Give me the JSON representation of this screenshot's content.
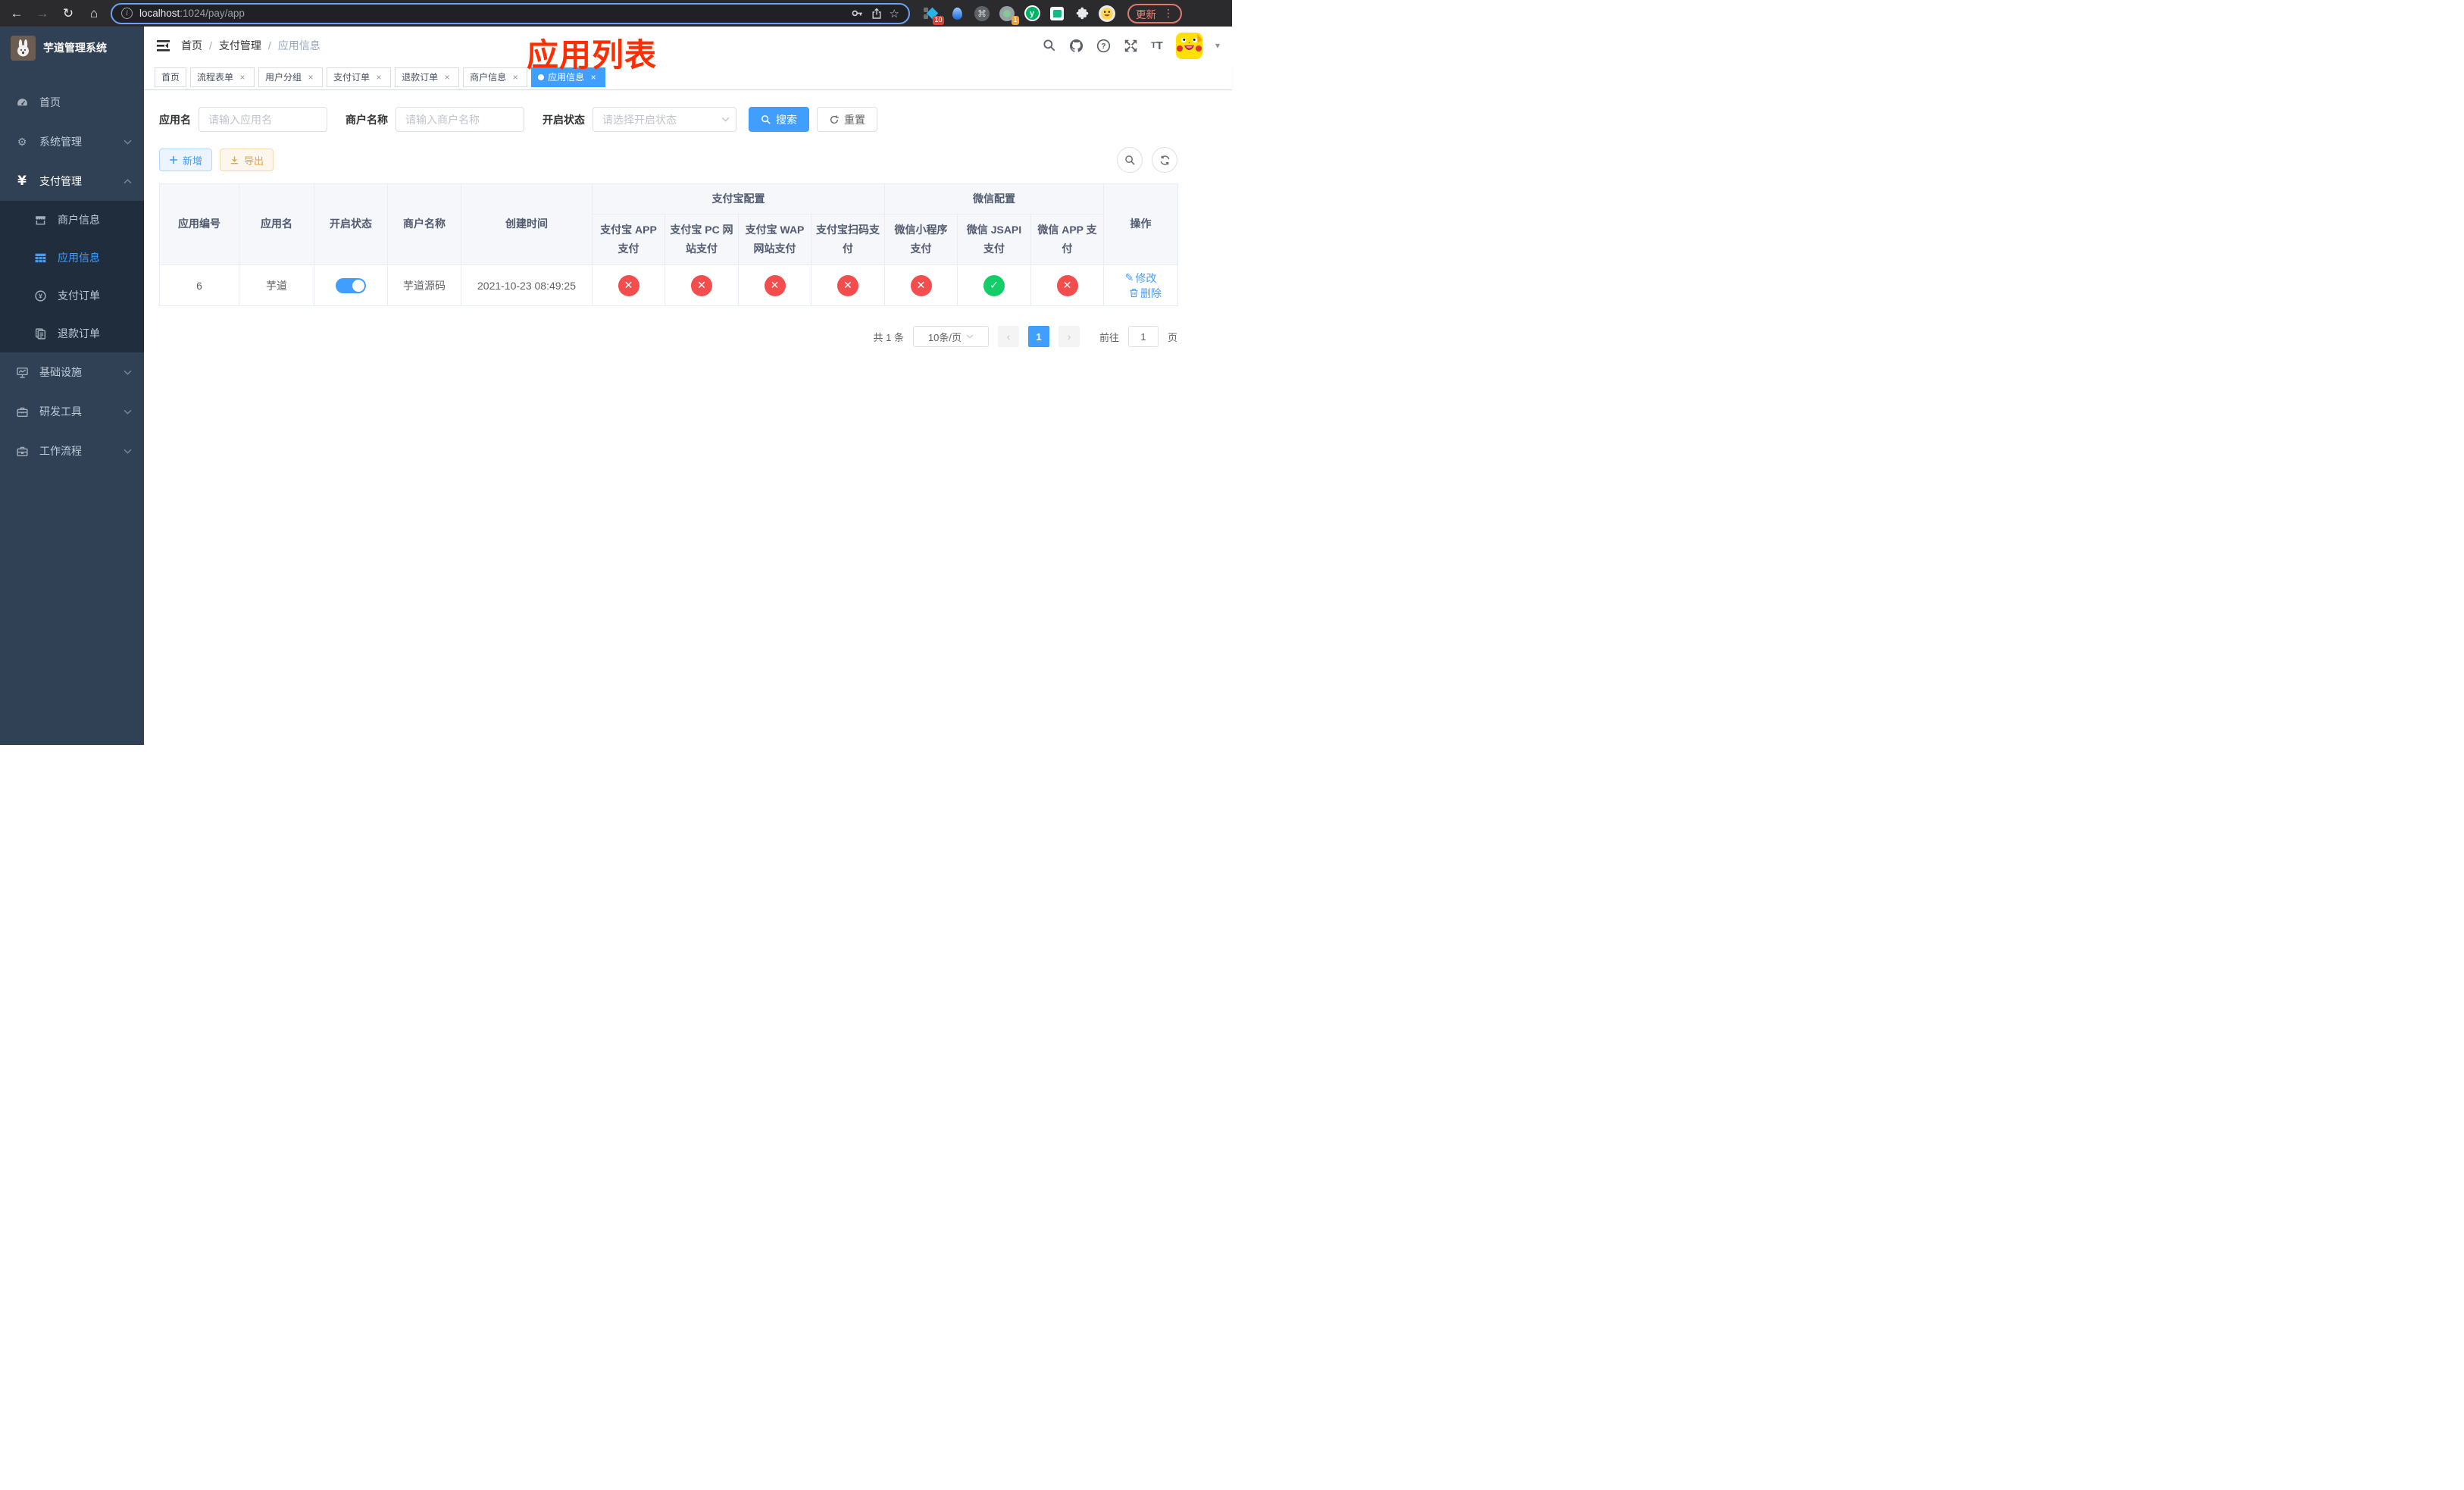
{
  "colors": {
    "accent": "#409EFF",
    "success": "#13ce66",
    "danger": "#f34d4d"
  },
  "icons": {
    "back": "←",
    "forward": "→",
    "reload": "↻",
    "home": "⌂",
    "star": "☆",
    "command": "⌘",
    "menu_dots": "⋮",
    "caret_down": "▾",
    "gear": "⚙",
    "yen": "¥",
    "edit": "✎",
    "info": "i",
    "close": "×",
    "pager_prev": "‹",
    "pager_next": "›",
    "y_logo": "y",
    "question": "?"
  },
  "browser": {
    "url_host": "localhost",
    "url_rest": ":1024/pay/app",
    "update_label": "更新",
    "ext_badge_blue_diamond": "10",
    "ext_badge_recorder": "1"
  },
  "sidebar": {
    "title": "芋道管理系统",
    "items": [
      {
        "label": "首页"
      },
      {
        "label": "系统管理"
      },
      {
        "label": "支付管理"
      },
      {
        "label": "基础设施"
      },
      {
        "label": "研发工具"
      },
      {
        "label": "工作流程"
      }
    ],
    "submenu": [
      {
        "label": "商户信息"
      },
      {
        "label": "应用信息"
      },
      {
        "label": "支付订单"
      },
      {
        "label": "退款订单"
      }
    ]
  },
  "navbar": {
    "breadcrumb": [
      "首页",
      "支付管理",
      "应用信息"
    ],
    "separator": "/",
    "annotation": "应用列表"
  },
  "tabs": [
    {
      "label": "首页"
    },
    {
      "label": "流程表单"
    },
    {
      "label": "用户分组"
    },
    {
      "label": "支付订单"
    },
    {
      "label": "退款订单"
    },
    {
      "label": "商户信息"
    },
    {
      "label": "应用信息"
    }
  ],
  "filters": {
    "app_name_label": "应用名",
    "app_name_placeholder": "请输入应用名",
    "merchant_label": "商户名称",
    "merchant_placeholder": "请输入商户名称",
    "status_label": "开启状态",
    "status_placeholder": "请选择开启状态",
    "search_label": "搜索",
    "reset_label": "重置"
  },
  "toolbar": {
    "add_label": "新增",
    "export_label": "导出"
  },
  "table": {
    "headers": {
      "app_id": "应用编号",
      "app_name": "应用名",
      "status": "开启状态",
      "merchant": "商户名称",
      "created": "创建时间",
      "alipay_group": "支付宝配置",
      "wechat_group": "微信配置",
      "actions": "操作",
      "sub": [
        "支付宝 APP 支付",
        "支付宝 PC 网站支付",
        "支付宝 WAP 网站支付",
        "支付宝扫码支付",
        "微信小程序支付",
        "微信 JSAPI 支付",
        "微信 APP 支付"
      ]
    },
    "rows": [
      {
        "app_id": "6",
        "app_name": "芋道",
        "enabled": true,
        "merchant": "芋道源码",
        "created": "2021-10-23 08:49:25",
        "configs": [
          false,
          false,
          false,
          false,
          false,
          true,
          false
        ],
        "edit_label": "修改",
        "delete_label": "删除"
      }
    ]
  },
  "pagination": {
    "total_text": "共 1 条",
    "page_size": "10条/页",
    "current_page": "1",
    "goto_label": "前往",
    "goto_value": "1",
    "page_unit": "页"
  }
}
